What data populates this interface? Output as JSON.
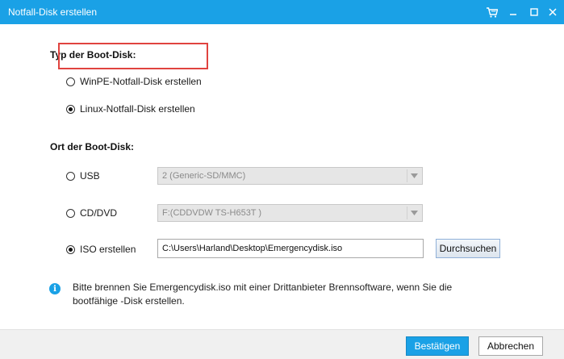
{
  "window": {
    "title": "Notfall-Disk erstellen"
  },
  "boot_type": {
    "heading": "Typ der Boot-Disk:",
    "options": [
      {
        "label": "WinPE-Notfall-Disk erstellen",
        "selected": false
      },
      {
        "label": "Linux-Notfall-Disk erstellen",
        "selected": true
      }
    ]
  },
  "boot_location": {
    "heading": "Ort der Boot-Disk:",
    "usb": {
      "label": "USB",
      "selected": false,
      "value": "2 (Generic-SD/MMC)"
    },
    "cddvd": {
      "label": "CD/DVD",
      "selected": false,
      "value": "F:(CDDVDW TS-H653T )"
    },
    "iso": {
      "label": "ISO erstellen",
      "selected": true,
      "path": "C:\\Users\\Harland\\Desktop\\Emergencydisk.iso",
      "browse_label": "Durchsuchen"
    }
  },
  "info": {
    "text_line1": "Bitte brennen Sie Emergencydisk.iso mit einer Drittanbieter Brennsoftware, wenn Sie die",
    "text_line2": "bootfähige -Disk erstellen."
  },
  "footer": {
    "confirm_label": "Bestätigen",
    "cancel_label": "Abbrechen"
  },
  "colors": {
    "accent": "#1aa1e6",
    "highlight": "#e0433f"
  }
}
